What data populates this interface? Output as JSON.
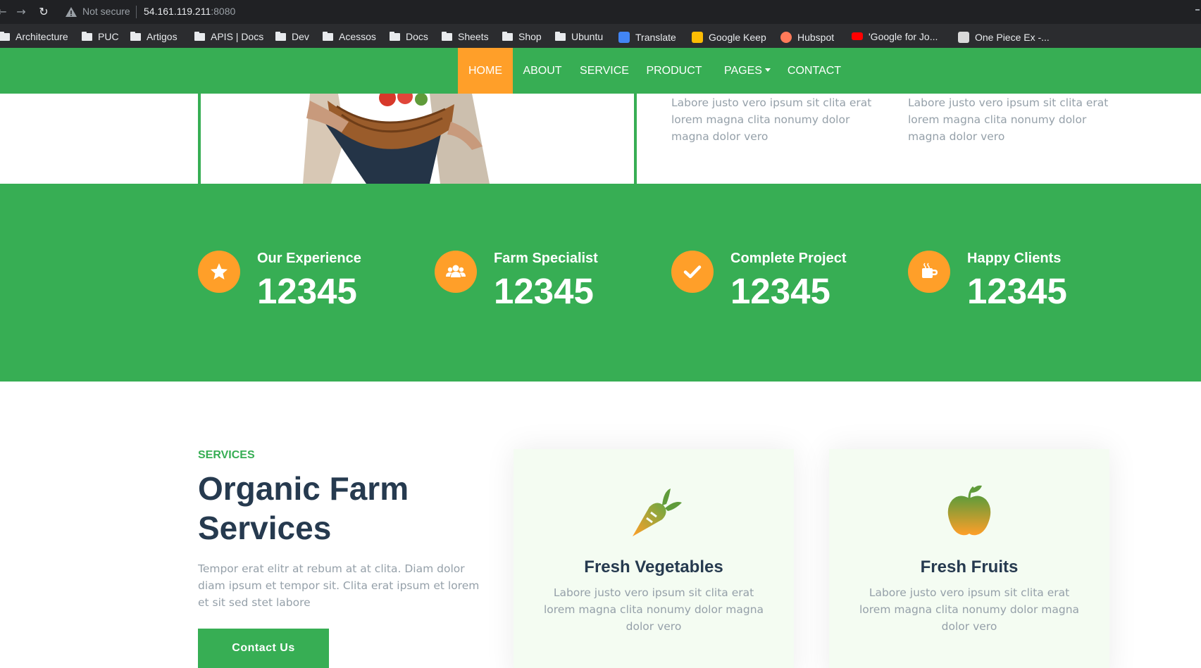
{
  "browser": {
    "security_label": "Not secure",
    "url_host": "54.161.119.211",
    "url_port": ":8080"
  },
  "bookmarks": [
    {
      "label": "Architecture",
      "icon": "folder-icon"
    },
    {
      "label": "PUC",
      "icon": "folder-icon"
    },
    {
      "label": "Artigos",
      "icon": "folder-icon"
    },
    {
      "label": "APIS | Docs",
      "icon": "folder-icon"
    },
    {
      "label": "Dev",
      "icon": "folder-icon"
    },
    {
      "label": "Acessos",
      "icon": "folder-icon"
    },
    {
      "label": "Docs",
      "icon": "folder-icon"
    },
    {
      "label": "Sheets",
      "icon": "folder-icon"
    },
    {
      "label": "Shop",
      "icon": "folder-icon"
    },
    {
      "label": "Ubuntu",
      "icon": "folder-icon"
    },
    {
      "label": "Translate",
      "icon": "google-translate-icon",
      "color": "#4285f4"
    },
    {
      "label": "Google Keep",
      "icon": "google-keep-icon",
      "color": "#fbbc04"
    },
    {
      "label": "Hubspot",
      "icon": "hubspot-icon",
      "color": "#ff7a59"
    },
    {
      "label": "'Google for Jo...",
      "icon": "youtube-icon",
      "color": "#ff0000"
    },
    {
      "label": "One Piece Ex -...",
      "icon": "one-piece-icon",
      "color": "#d9d9d9"
    }
  ],
  "nav": {
    "items": [
      "HOME",
      "ABOUT",
      "SERVICE",
      "PRODUCT",
      "PAGES",
      "CONTACT"
    ],
    "active": "HOME"
  },
  "hero": {
    "text_1": "Labore justo vero ipsum sit clita erat lorem magna clita nonumy dolor magna dolor vero",
    "text_2": "Labore justo vero ipsum sit clita erat lorem magna clita nonumy dolor magna dolor vero"
  },
  "facts": [
    {
      "label": "Our Experience",
      "count": "12345",
      "icon": "star-icon"
    },
    {
      "label": "Farm Specialist",
      "count": "12345",
      "icon": "users-icon"
    },
    {
      "label": "Complete Project",
      "count": "12345",
      "icon": "check-icon"
    },
    {
      "label": "Happy Clients",
      "count": "12345",
      "icon": "mug-icon"
    }
  ],
  "services": {
    "eyebrow": "Services",
    "title": "Organic Farm Services",
    "description": "Tempor erat elitr at rebum at at clita. Diam dolor diam ipsum et tempor sit. Clita erat ipsum et lorem et sit sed stet labore",
    "button_label": "Contact Us",
    "cards": [
      {
        "title": "Fresh Vegetables",
        "text": "Labore justo vero ipsum sit clita erat lorem magna clita nonumy dolor magna dolor vero",
        "icon": "carrot-icon"
      },
      {
        "title": "Fresh Fruits",
        "text": "Labore justo vero ipsum sit clita erat lorem magna clita nonumy dolor magna dolor vero",
        "icon": "apple-icon"
      }
    ]
  },
  "colors": {
    "primary": "#37ae54",
    "accent": "#ff9f29",
    "heading": "#263a4f",
    "muted": "#95a0a9"
  }
}
